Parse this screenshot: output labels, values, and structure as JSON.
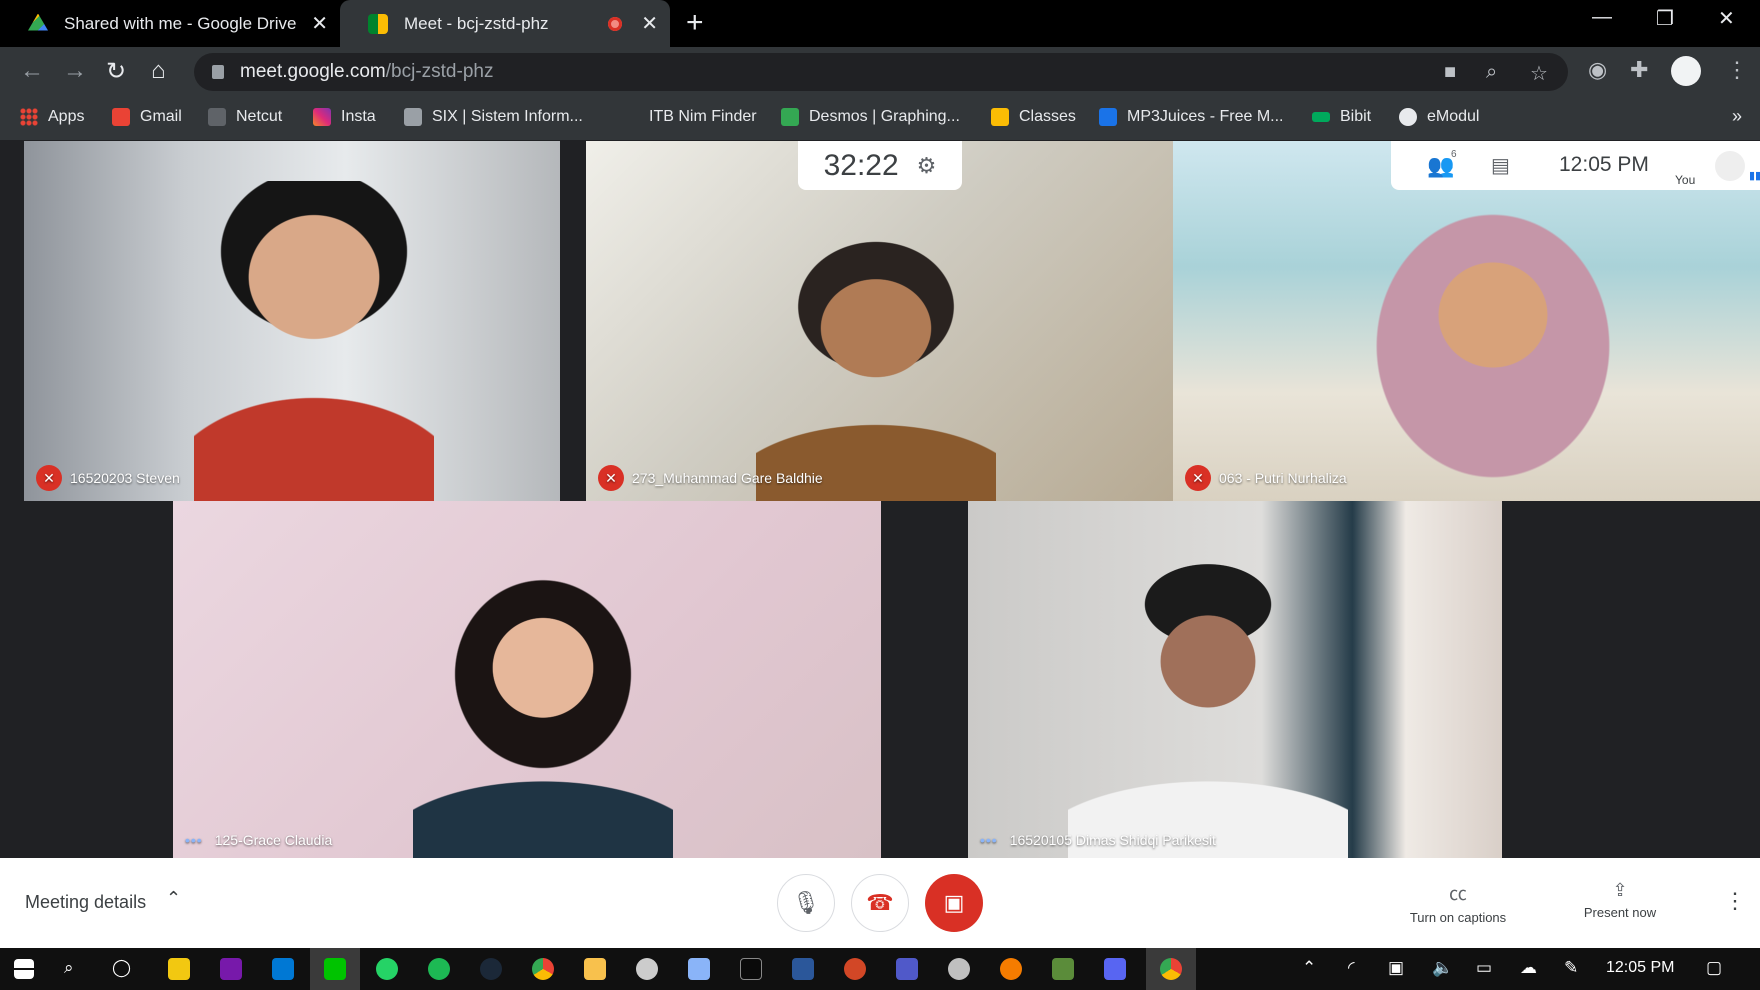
{
  "browser": {
    "tabs": [
      {
        "title": "Shared with me - Google Drive",
        "favicon": "google-drive-icon"
      },
      {
        "title": "Meet - bcj-zstd-phz",
        "favicon": "google-meet-icon",
        "recording": true
      }
    ],
    "new_tab": "+",
    "url_host": "meet.google.com",
    "url_path": "/bcj-zstd-phz"
  },
  "bookmarks": [
    {
      "label": "Apps",
      "color": "#ea4335"
    },
    {
      "label": "Gmail",
      "color": "#ea4335"
    },
    {
      "label": "Netcut",
      "color": "#5f6368"
    },
    {
      "label": "Insta",
      "color": "#c13584"
    },
    {
      "label": "SIX | Sistem Inform...",
      "color": "#9aa0a6"
    },
    {
      "label": "ITB Nim Finder",
      "color": "#323639"
    },
    {
      "label": "Desmos | Graphing...",
      "color": "#34a853"
    },
    {
      "label": "Classes",
      "color": "#fbbc04"
    },
    {
      "label": "MP3Juices - Free M...",
      "color": "#1a73e8"
    },
    {
      "label": "Bibit",
      "color": "#00a95c"
    },
    {
      "label": "eModul",
      "color": "#e8eaed"
    }
  ],
  "bookmarks_more": "»",
  "timer": {
    "value": "32:22"
  },
  "info": {
    "people_count": "6",
    "time": "12:05 PM",
    "you": "You"
  },
  "participants": [
    {
      "name": "16520203 Steven",
      "muted": true
    },
    {
      "name": "273_Muhammad Gare Baldhie",
      "muted": true
    },
    {
      "name": "063 - Putri Nurhaliza",
      "muted": true
    },
    {
      "name": "125-Grace Claudia",
      "muted": false
    },
    {
      "name": "16520105 Dimas Shidqi Parikesit",
      "muted": false
    }
  ],
  "controls": {
    "meeting_details": "Meeting details",
    "captions": "Turn on captions",
    "present": "Present now"
  },
  "colors": {
    "accent_red": "#d93025",
    "accent_blue": "#1a73e8"
  },
  "taskbar": {
    "time": "12:05 PM"
  }
}
